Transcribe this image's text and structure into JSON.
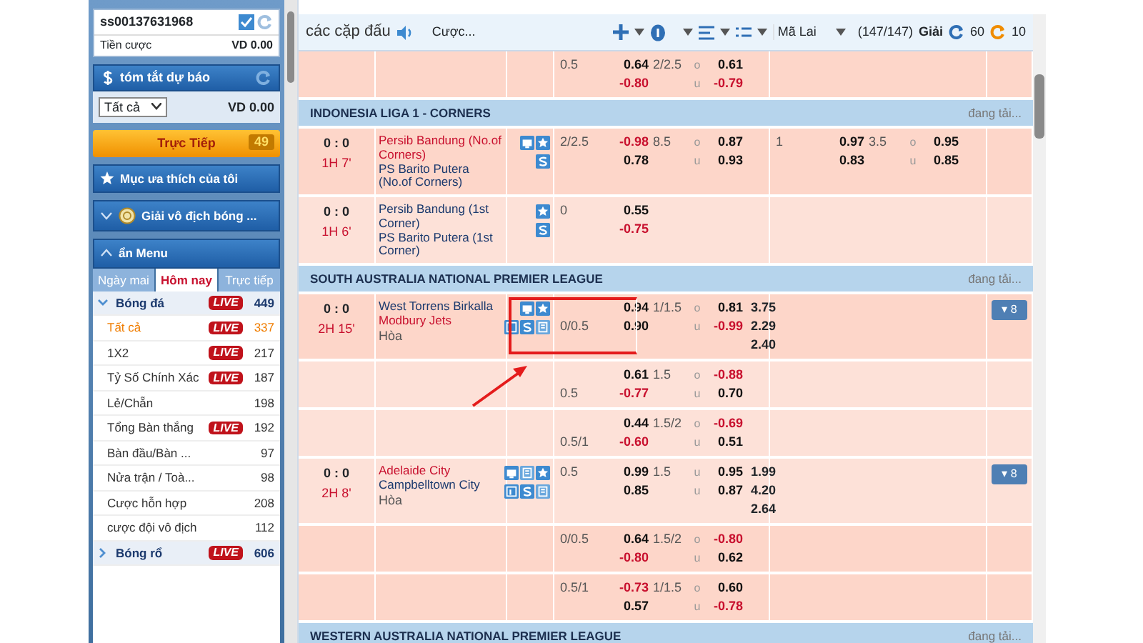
{
  "sidebar": {
    "account": {
      "id": "ss00137631968",
      "stake_label": "Tiền cược",
      "stake_value": "VD 0.00"
    },
    "summary": {
      "title": "tóm tắt dự báo",
      "filter": "Tất cả",
      "value": "VD 0.00"
    },
    "live_button": {
      "label": "Trực Tiếp",
      "count": "49"
    },
    "sections": [
      {
        "kind": "favorites",
        "label": "Mục ưa thích của tôi"
      },
      {
        "kind": "league",
        "label": "Giải vô địch bóng ...",
        "expanded": false
      },
      {
        "kind": "menu",
        "label": "ẩn Menu",
        "expanded": true
      }
    ],
    "tabs": [
      {
        "label": "Ngày mai",
        "selected": false
      },
      {
        "label": "Hôm nay",
        "selected": true
      },
      {
        "label": "Trực tiếp",
        "selected": false
      }
    ],
    "sports": [
      {
        "name": "Bóng đá",
        "badge": "LIVE",
        "count": "449",
        "expanded": true,
        "children": [
          {
            "name": "Tất cả",
            "badge": "LIVE",
            "count": "337",
            "selected": true
          },
          {
            "name": "1X2",
            "badge": "LIVE",
            "count": "217",
            "selected": false
          },
          {
            "name": "Tỷ Số Chính Xác",
            "badge": "LIVE",
            "count": "187",
            "selected": false
          },
          {
            "name": "Lẻ/Chẵn",
            "count": "198",
            "selected": false
          },
          {
            "name": "Tổng Bàn thắng",
            "badge": "LIVE",
            "count": "192",
            "selected": false
          },
          {
            "name": "Bàn đầu/Bàn ...",
            "count": "97",
            "selected": false
          },
          {
            "name": "Nửa trận / Toà...",
            "count": "98",
            "selected": false
          },
          {
            "name": "Cược hỗn hợp",
            "count": "208",
            "selected": false
          },
          {
            "name": "cược đội vô địch",
            "count": "112",
            "selected": false
          }
        ]
      },
      {
        "name": "Bóng rổ",
        "badge": "LIVE",
        "count": "606",
        "expanded": false
      }
    ]
  },
  "main": {
    "header": {
      "title": "các cặp đấu",
      "bet_label": "Cược...",
      "odds_type": "Mã Lai",
      "league_count": "(147/147)",
      "league_label": "Giải",
      "refresh_a": "60",
      "refresh_b": "10"
    },
    "rows": [
      {
        "kind": "odds",
        "ft": {
          "odds": [
            {
              "hdp": "0.5",
              "v": "0.64",
              "neg": false
            },
            {
              "v": "-0.80",
              "neg": true
            }
          ],
          "ou": "2/2.5",
          "ou_marks": [
            "o",
            "u"
          ],
          "ou_odds": [
            {
              "v": "0.61",
              "neg": false
            },
            {
              "v": "-0.79",
              "neg": true
            }
          ]
        }
      },
      {
        "kind": "league",
        "name": "INDONESIA LIGA 1 - CORNERS",
        "status": "đang tải..."
      },
      {
        "kind": "match",
        "score": "0 : 0",
        "time": "1H 7'",
        "highlighted": false,
        "teams": [
          {
            "name": "Persib Bandung (No.of Corners)",
            "favored": true
          },
          {
            "name": "PS Barito Putera (No.of Corners)",
            "favored": false
          }
        ],
        "icons": [
          [
            {
              "kind": "tv"
            },
            {
              "kind": "star"
            }
          ],
          [
            {
              "kind": "s"
            }
          ]
        ],
        "ft": {
          "odds": [
            {
              "hdp": "2/2.5",
              "v": "-0.98",
              "neg": true
            },
            {
              "v": "0.78",
              "neg": false
            }
          ],
          "ou": "8.5",
          "ou_marks": [
            "o",
            "u"
          ],
          "ou_odds": [
            {
              "v": "0.87",
              "neg": false
            },
            {
              "v": "0.93",
              "neg": false
            }
          ]
        },
        "h1": {
          "odds": [
            {
              "hdp": "1",
              "v": "0.97",
              "neg": false
            },
            {
              "v": "0.83",
              "neg": false
            }
          ],
          "ou": "3.5",
          "ou_marks": [
            "o",
            "u"
          ],
          "ou_odds": [
            {
              "v": "0.95",
              "neg": false
            },
            {
              "v": "0.85",
              "neg": false
            }
          ]
        }
      },
      {
        "kind": "match",
        "score": "0 : 0",
        "time": "1H 6'",
        "highlighted": false,
        "teams": [
          {
            "name": "Persib Bandung (1st Corner)",
            "favored": false
          },
          {
            "name": "PS Barito Putera (1st Corner)",
            "favored": false
          }
        ],
        "icons": [
          [
            {
              "kind": "star"
            }
          ],
          [
            {
              "kind": "s"
            }
          ]
        ],
        "ft": {
          "odds": [
            {
              "hdp": "0",
              "v": "0.55",
              "neg": false
            },
            {
              "v": "-0.75",
              "neg": true
            }
          ]
        }
      },
      {
        "kind": "league",
        "name": "SOUTH AUSTRALIA NATIONAL PREMIER LEAGUE",
        "status": "đang tải..."
      },
      {
        "kind": "match",
        "score": "0 : 0",
        "time": "2H 15'",
        "highlighted": true,
        "teams": [
          {
            "name": "West Torrens Birkalla",
            "favored": false
          },
          {
            "name": "Modbury Jets",
            "favored": true
          }
        ],
        "draw": "Hòa",
        "icons": [
          [
            {
              "kind": "tv"
            },
            {
              "kind": "star"
            }
          ],
          [
            {
              "kind": "stats"
            },
            {
              "kind": "s"
            },
            {
              "kind": "doc"
            }
          ]
        ],
        "ft": {
          "odds": [
            {
              "v": "0.94",
              "neg": false
            },
            {
              "hdp": "0/0.5",
              "v": "0.90",
              "neg": false
            }
          ],
          "ou": "1/1.5",
          "ou_marks": [
            "o",
            "u"
          ],
          "ou_odds": [
            {
              "v": "0.81",
              "neg": false
            },
            {
              "v": "-0.99",
              "neg": true
            }
          ],
          "x12": [
            "3.75",
            "2.29",
            "2.40"
          ]
        },
        "more": "▾ 8"
      },
      {
        "kind": "odds",
        "ft": {
          "odds": [
            {
              "v": "0.61",
              "neg": false
            },
            {
              "hdp": "0.5",
              "v": "-0.77",
              "neg": true
            }
          ],
          "ou": "1.5",
          "ou_marks": [
            "o",
            "u"
          ],
          "ou_odds": [
            {
              "v": "-0.88",
              "neg": true
            },
            {
              "v": "0.70",
              "neg": false
            }
          ]
        }
      },
      {
        "kind": "odds",
        "ft": {
          "odds": [
            {
              "v": "0.44",
              "neg": false
            },
            {
              "hdp": "0.5/1",
              "v": "-0.60",
              "neg": true
            }
          ],
          "ou": "1.5/2",
          "ou_marks": [
            "o",
            "u"
          ],
          "ou_odds": [
            {
              "v": "-0.69",
              "neg": true
            },
            {
              "v": "0.51",
              "neg": false
            }
          ]
        }
      },
      {
        "kind": "match",
        "score": "0 : 0",
        "time": "2H 8'",
        "highlighted": false,
        "teams": [
          {
            "name": "Adelaide City",
            "favored": true
          },
          {
            "name": "Campbelltown City",
            "favored": false
          }
        ],
        "draw": "Hòa",
        "icons": [
          [
            {
              "kind": "tv"
            },
            {
              "kind": "doc"
            },
            {
              "kind": "star"
            }
          ],
          [
            {
              "kind": "stats"
            },
            {
              "kind": "s"
            },
            {
              "kind": "doc"
            }
          ]
        ],
        "ft": {
          "odds": [
            {
              "hdp": "0.5",
              "v": "0.99",
              "neg": false
            },
            {
              "v": "0.85",
              "neg": false
            }
          ],
          "ou": "1.5",
          "ou_marks": [
            "u",
            "u"
          ],
          "ou_odds": [
            {
              "v": "0.95",
              "neg": false
            },
            {
              "v": "0.87",
              "neg": false
            }
          ],
          "x12": [
            "1.99",
            "4.20",
            "2.64"
          ]
        },
        "more": "▾ 8"
      },
      {
        "kind": "odds",
        "ft": {
          "odds": [
            {
              "hdp": "0/0.5",
              "v": "0.64",
              "neg": false
            },
            {
              "v": "-0.80",
              "neg": true
            }
          ],
          "ou": "1.5/2",
          "ou_marks": [
            "o",
            "u"
          ],
          "ou_odds": [
            {
              "v": "-0.80",
              "neg": true
            },
            {
              "v": "0.62",
              "neg": false
            }
          ]
        }
      },
      {
        "kind": "odds",
        "ft": {
          "odds": [
            {
              "hdp": "0.5/1",
              "v": "-0.73",
              "neg": true
            },
            {
              "v": "0.57",
              "neg": false
            }
          ],
          "ou": "1/1.5",
          "ou_marks": [
            "o",
            "u"
          ],
          "ou_odds": [
            {
              "v": "0.60",
              "neg": false
            },
            {
              "v": "-0.78",
              "neg": true
            }
          ]
        }
      },
      {
        "kind": "league",
        "name": "WESTERN AUSTRALIA NATIONAL PREMIER LEAGUE",
        "status": "đang tải..."
      }
    ]
  }
}
